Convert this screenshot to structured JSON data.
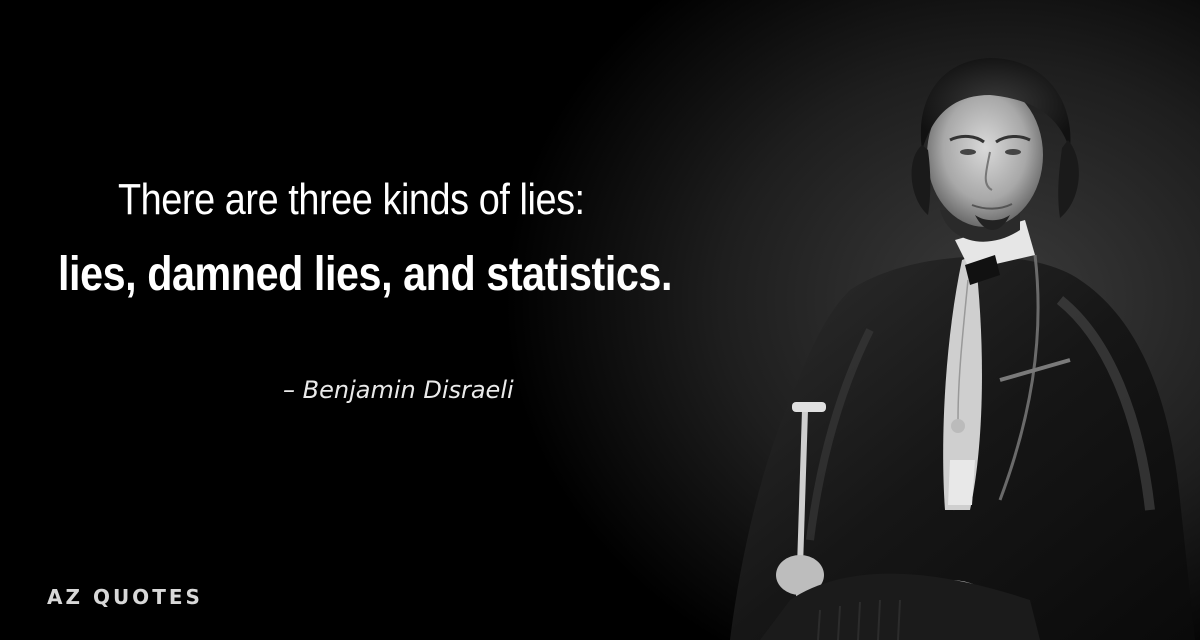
{
  "quote": {
    "line1": "There are three kinds of lies:",
    "line2": "lies, damned lies, and statistics."
  },
  "author": "– Benjamin Disraeli",
  "logo": {
    "text": "AZ QUOTES"
  },
  "portrait": {
    "icon": "portrait-photo-icon"
  },
  "colors": {
    "background": "#000000",
    "text": "#ffffff",
    "logo": "#d8d8d8"
  }
}
